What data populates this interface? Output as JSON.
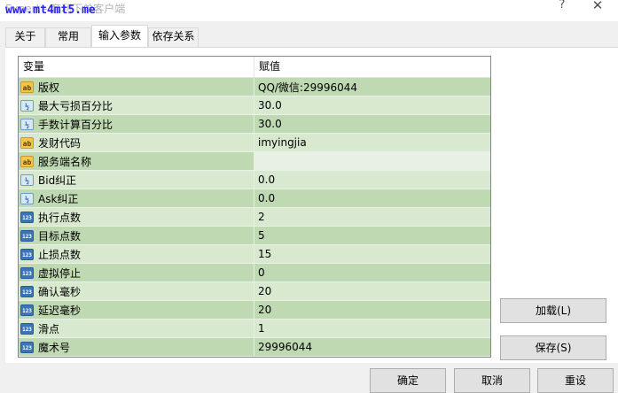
{
  "window": {
    "title": "Expert - 套利下单客户端",
    "watermark": "www.mt4mt5.me",
    "help_glyph": "?",
    "close_glyph": "✕"
  },
  "tabs": [
    {
      "label": "关于",
      "active": false
    },
    {
      "label": "常用",
      "active": false
    },
    {
      "label": "输入参数",
      "active": true
    },
    {
      "label": "依存关系",
      "active": false
    }
  ],
  "grid": {
    "col_variable": "变量",
    "col_value": "赋值",
    "rows": [
      {
        "type": "ab",
        "name": "版权",
        "value": "QQ/微信:29996044"
      },
      {
        "type": "v2",
        "name": "最大亏损百分比",
        "value": "30.0"
      },
      {
        "type": "v2",
        "name": "手数计算百分比",
        "value": "30.0"
      },
      {
        "type": "ab",
        "name": "发财代码",
        "value": "imyingjia"
      },
      {
        "type": "ab",
        "name": "服务端名称",
        "value": ""
      },
      {
        "type": "v2",
        "name": "Bid纠正",
        "value": "0.0"
      },
      {
        "type": "v2",
        "name": "Ask纠正",
        "value": "0.0"
      },
      {
        "type": "123",
        "name": "执行点数",
        "value": "2"
      },
      {
        "type": "123",
        "name": "目标点数",
        "value": "5"
      },
      {
        "type": "123",
        "name": "止损点数",
        "value": "15"
      },
      {
        "type": "123",
        "name": "虚拟停止",
        "value": "0"
      },
      {
        "type": "123",
        "name": "确认毫秒",
        "value": "20"
      },
      {
        "type": "123",
        "name": "延迟毫秒",
        "value": "20"
      },
      {
        "type": "123",
        "name": "滑点",
        "value": "1"
      },
      {
        "type": "123",
        "name": "魔术号",
        "value": "29996044"
      }
    ]
  },
  "buttons": {
    "load": "加载(L)",
    "save": "保存(S)",
    "ok": "确定",
    "cancel": "取消",
    "reset": "重设"
  },
  "icons": {
    "ab": "string-type-icon",
    "v2": "double-type-icon",
    "123": "integer-type-icon"
  },
  "colors": {
    "row_even": "#d8e9d0",
    "row_odd": "#bfd9b2",
    "watermark": "#2a24f0"
  }
}
